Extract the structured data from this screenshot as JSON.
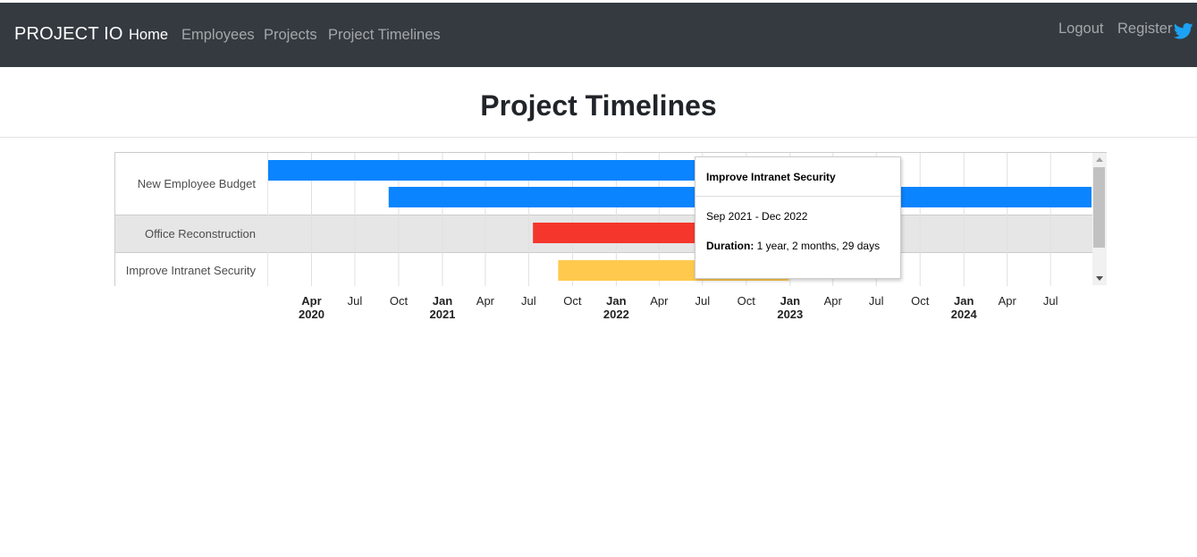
{
  "nav": {
    "brand": "PROJECT IO",
    "links": [
      {
        "label": "Home",
        "active": true
      },
      {
        "label": "Employees",
        "active": false
      },
      {
        "label": "Projects",
        "active": false
      },
      {
        "label": "Project Timelines",
        "active": false
      }
    ],
    "right_links": [
      {
        "label": "Logout"
      },
      {
        "label": "Register"
      }
    ],
    "social_icon": "twitter-icon"
  },
  "page": {
    "title": "Project Timelines"
  },
  "chart_data": {
    "type": "timeline",
    "rows": [
      {
        "label": "New Employee Budget",
        "bars": [
          {
            "start": "2020-01-01",
            "end": "2022-06-30",
            "color": "#0a84ff"
          },
          {
            "start": "2020-09-10",
            "end": "2024-09-25",
            "color": "#0a84ff"
          }
        ]
      },
      {
        "label": "Office Reconstruction",
        "bars": [
          {
            "start": "2021-07-10",
            "end": "2022-06-30",
            "color": "#f4362c"
          }
        ]
      },
      {
        "label": "Improve Intranet Security",
        "bars": [
          {
            "start": "2021-09-01",
            "end": "2022-12-29",
            "color": "#ffc94d"
          }
        ]
      }
    ],
    "axis": {
      "start": "2020-01-01",
      "end": "2024-09-25",
      "ticks": [
        {
          "month": "Apr",
          "year": "2020"
        },
        {
          "month": "Jul",
          "year": ""
        },
        {
          "month": "Oct",
          "year": ""
        },
        {
          "month": "Jan",
          "year": "2021"
        },
        {
          "month": "Apr",
          "year": ""
        },
        {
          "month": "Jul",
          "year": ""
        },
        {
          "month": "Oct",
          "year": ""
        },
        {
          "month": "Jan",
          "year": "2022"
        },
        {
          "month": "Apr",
          "year": ""
        },
        {
          "month": "Jul",
          "year": ""
        },
        {
          "month": "Oct",
          "year": ""
        },
        {
          "month": "Jan",
          "year": "2023"
        },
        {
          "month": "Apr",
          "year": ""
        },
        {
          "month": "Jul",
          "year": ""
        },
        {
          "month": "Oct",
          "year": ""
        },
        {
          "month": "Jan",
          "year": "2024"
        },
        {
          "month": "Apr",
          "year": ""
        },
        {
          "month": "Jul",
          "year": ""
        }
      ]
    },
    "highlighted_row": 1,
    "colors": {
      "row_highlight": "#e6e6e6",
      "grid": "#e0e0e0"
    }
  },
  "tooltip": {
    "title": "Improve Intranet Security",
    "range": "Sep 2021 - Dec 2022",
    "duration_label": "Duration:",
    "duration_value": "1 year, 2 months, 29 days"
  }
}
